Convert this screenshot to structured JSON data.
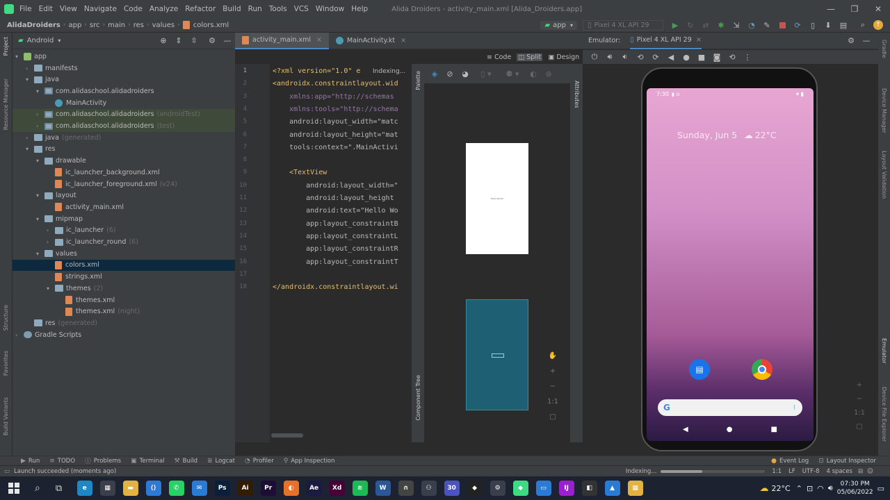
{
  "window": {
    "title": "Alida Droiders - activity_main.xml [Alida_Droiders.app]"
  },
  "menu": [
    "File",
    "Edit",
    "View",
    "Navigate",
    "Code",
    "Analyze",
    "Refactor",
    "Build",
    "Run",
    "Tools",
    "VCS",
    "Window",
    "Help"
  ],
  "breadcrumb": [
    "AlidaDroiders",
    "app",
    "src",
    "main",
    "res",
    "values",
    "colors.xml"
  ],
  "run_config": "app",
  "device_selector": "Pixel 4 XL API 29",
  "project_panel": {
    "view": "Android"
  },
  "tree": [
    {
      "label": "app",
      "note": "",
      "indent": 0,
      "icon": "app",
      "arrow": "▾"
    },
    {
      "label": "manifests",
      "note": "",
      "indent": 1,
      "icon": "folder",
      "arrow": "›"
    },
    {
      "label": "java",
      "note": "",
      "indent": 1,
      "icon": "folder",
      "arrow": "▾"
    },
    {
      "label": "com.alidaschool.alidadroiders",
      "note": "",
      "indent": 2,
      "icon": "pkg",
      "arrow": "▾"
    },
    {
      "label": "MainActivity",
      "note": "",
      "indent": 3,
      "icon": "kt",
      "arrow": ""
    },
    {
      "label": "com.alidaschool.alidadroiders",
      "note": "(androidTest)",
      "indent": 2,
      "icon": "pkg",
      "arrow": "›",
      "hl": true
    },
    {
      "label": "com.alidaschool.alidadroiders",
      "note": "(test)",
      "indent": 2,
      "icon": "pkg",
      "arrow": "›",
      "hl": true
    },
    {
      "label": "java",
      "note": "(generated)",
      "indent": 1,
      "icon": "folder",
      "arrow": "›"
    },
    {
      "label": "res",
      "note": "",
      "indent": 1,
      "icon": "folder",
      "arrow": "▾"
    },
    {
      "label": "drawable",
      "note": "",
      "indent": 2,
      "icon": "folder",
      "arrow": "▾"
    },
    {
      "label": "ic_launcher_background.xml",
      "note": "",
      "indent": 3,
      "icon": "xml",
      "arrow": ""
    },
    {
      "label": "ic_launcher_foreground.xml",
      "note": "(v24)",
      "indent": 3,
      "icon": "xml",
      "arrow": ""
    },
    {
      "label": "layout",
      "note": "",
      "indent": 2,
      "icon": "folder",
      "arrow": "▾"
    },
    {
      "label": "activity_main.xml",
      "note": "",
      "indent": 3,
      "icon": "xml",
      "arrow": ""
    },
    {
      "label": "mipmap",
      "note": "",
      "indent": 2,
      "icon": "folder",
      "arrow": "▾"
    },
    {
      "label": "ic_launcher",
      "note": "(6)",
      "indent": 3,
      "icon": "folder",
      "arrow": "›"
    },
    {
      "label": "ic_launcher_round",
      "note": "(6)",
      "indent": 3,
      "icon": "folder",
      "arrow": "›"
    },
    {
      "label": "values",
      "note": "",
      "indent": 2,
      "icon": "folder",
      "arrow": "▾"
    },
    {
      "label": "colors.xml",
      "note": "",
      "indent": 3,
      "icon": "xml",
      "arrow": "",
      "sel": true
    },
    {
      "label": "strings.xml",
      "note": "",
      "indent": 3,
      "icon": "xml",
      "arrow": ""
    },
    {
      "label": "themes",
      "note": "(2)",
      "indent": 3,
      "icon": "folder",
      "arrow": "▾"
    },
    {
      "label": "themes.xml",
      "note": "",
      "indent": 4,
      "icon": "xml",
      "arrow": ""
    },
    {
      "label": "themes.xml",
      "note": "(night)",
      "indent": 4,
      "icon": "xml",
      "arrow": ""
    },
    {
      "label": "res",
      "note": "(generated)",
      "indent": 1,
      "icon": "folder",
      "arrow": ""
    },
    {
      "label": "Gradle Scripts",
      "note": "",
      "indent": 0,
      "icon": "gradle",
      "arrow": "›"
    }
  ],
  "left_strip": [
    "Project",
    "Resource Manager",
    "Structure",
    "Favorites",
    "Build Variants"
  ],
  "editor_tabs": [
    "activity_main.xml",
    "MainActivity.kt"
  ],
  "view_modes": [
    "Code",
    "Split",
    "Design"
  ],
  "indexing_hint": "Indexing...",
  "code_lines": [
    {
      "n": "1",
      "t": "<?xml version=\"1.0\" e"
    },
    {
      "n": "2",
      "t": "<androidx.constraintlayout.wid"
    },
    {
      "n": "3",
      "t": "    xmlns:app=\"http://schemas"
    },
    {
      "n": "4",
      "t": "    xmlns:tools=\"http://schema"
    },
    {
      "n": "5",
      "t": "    android:layout_width=\"matc"
    },
    {
      "n": "6",
      "t": "    android:layout_height=\"mat"
    },
    {
      "n": "7",
      "t": "    tools:context=\".MainActivi"
    },
    {
      "n": "8",
      "t": ""
    },
    {
      "n": "9",
      "t": "    <TextView"
    },
    {
      "n": "10",
      "t": "        android:layout_width=\""
    },
    {
      "n": "11",
      "t": "        android:layout_height"
    },
    {
      "n": "12",
      "t": "        android:text=\"Hello Wo"
    },
    {
      "n": "13",
      "t": "        app:layout_constraintB"
    },
    {
      "n": "14",
      "t": "        app:layout_constraintL"
    },
    {
      "n": "15",
      "t": "        app:layout_constraintR"
    },
    {
      "n": "16",
      "t": "        app:layout_constraintT"
    },
    {
      "n": "17",
      "t": ""
    },
    {
      "n": "18",
      "t": "</androidx.constraintlayout.wi"
    }
  ],
  "palette": {
    "palette_label": "Palette",
    "component_tree_label": "Component Tree",
    "attributes_label": "Attributes",
    "preview_text": "Hello World!"
  },
  "emulator": {
    "label": "Emulator:",
    "device_tab": "Pixel 4 XL API 29"
  },
  "phone": {
    "time": "7:30",
    "date_weather": "Sunday, Jun 5",
    "temp": "22°C"
  },
  "right_strip": [
    "Gradle",
    "Device Manager",
    "Layout Validation",
    "Emulator",
    "Device File Explorer"
  ],
  "tool_windows": [
    "Run",
    "TODO",
    "Problems",
    "Terminal",
    "Build",
    "Logcat",
    "Profiler",
    "App Inspection"
  ],
  "tool_windows_right": [
    "Event Log",
    "Layout Inspector"
  ],
  "status": {
    "message": "Launch succeeded (moments ago)",
    "indexing": "Indexing...",
    "position": "1:1",
    "line_sep": "LF",
    "encoding": "UTF-8",
    "indent": "4 spaces"
  },
  "taskbar": {
    "apps": [
      {
        "name": "edge-icon",
        "color": "#1e88c7",
        "glyph": "e"
      },
      {
        "name": "store-icon",
        "color": "#3a3f4b",
        "glyph": "▦"
      },
      {
        "name": "explorer-icon",
        "color": "#e3b341",
        "glyph": "▬"
      },
      {
        "name": "vscode-icon",
        "color": "#2c7ad6",
        "glyph": "⟨⟩"
      },
      {
        "name": "whatsapp-icon",
        "color": "#25d366",
        "glyph": "✆"
      },
      {
        "name": "mail-icon",
        "color": "#2a7bd5",
        "glyph": "✉"
      },
      {
        "name": "photoshop-icon",
        "color": "#0b1f3a",
        "glyph": "Ps"
      },
      {
        "name": "illustrator-icon",
        "color": "#331c00",
        "glyph": "Ai"
      },
      {
        "name": "premiere-icon",
        "color": "#1d0c33",
        "glyph": "Pr"
      },
      {
        "name": "app-orange-icon",
        "color": "#e8712a",
        "glyph": "◐"
      },
      {
        "name": "aftereffects-icon",
        "color": "#1b1a40",
        "glyph": "Ae"
      },
      {
        "name": "xd-icon",
        "color": "#470137",
        "glyph": "Xd"
      },
      {
        "name": "spotify-icon",
        "color": "#1db954",
        "glyph": "≋"
      },
      {
        "name": "app-w-icon",
        "color": "#2b5797",
        "glyph": "W"
      },
      {
        "name": "app-n-icon",
        "color": "#444",
        "glyph": "∩"
      },
      {
        "name": "app-link-icon",
        "color": "#3a3f4b",
        "glyph": "⚇"
      },
      {
        "name": "teams-icon",
        "color": "#4b53bc",
        "glyph": "30"
      },
      {
        "name": "figma-icon",
        "color": "#222",
        "glyph": "◆"
      },
      {
        "name": "settings-icon",
        "color": "#3a3f4b",
        "glyph": "⚙"
      },
      {
        "name": "android-studio-icon",
        "color": "#3ddc84",
        "glyph": "◆"
      },
      {
        "name": "app-screen-icon",
        "color": "#2a7bd5",
        "glyph": "▭"
      },
      {
        "name": "intellij-icon",
        "color": "#9b1fd1",
        "glyph": "IJ"
      },
      {
        "name": "app-dark-icon",
        "color": "#333",
        "glyph": "◧"
      },
      {
        "name": "photos-icon",
        "color": "#2a7bd5",
        "glyph": "▲"
      },
      {
        "name": "app-grid-icon",
        "color": "#e3b341",
        "glyph": "▦"
      }
    ],
    "weather": "22°C",
    "time": "07:30 PM",
    "date": "05/06/2022"
  }
}
